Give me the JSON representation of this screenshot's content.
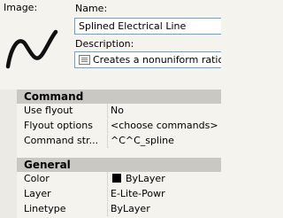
{
  "image_label": "Image:",
  "name_label": "Name:",
  "name_value": "Splined Electrical Line",
  "description_label": "Description:",
  "description_value": "Creates a nonuniform ratio",
  "command_section": {
    "title": "Command",
    "rows": [
      {
        "key": "Use flyout",
        "value": "No"
      },
      {
        "key": "Flyout options",
        "value": "<choose commands>"
      },
      {
        "key": "Command str...",
        "value": "^C^C_spline"
      }
    ]
  },
  "general_section": {
    "title": "General",
    "rows": [
      {
        "key": "Color",
        "value": "ByLayer",
        "swatch": "#000000"
      },
      {
        "key": "Layer",
        "value": "E-Lite-Powr"
      },
      {
        "key": "Linetype",
        "value": "ByLayer"
      }
    ]
  },
  "icons": [
    "spline-preview-icon",
    "description-icon",
    "color-swatch-icon"
  ]
}
